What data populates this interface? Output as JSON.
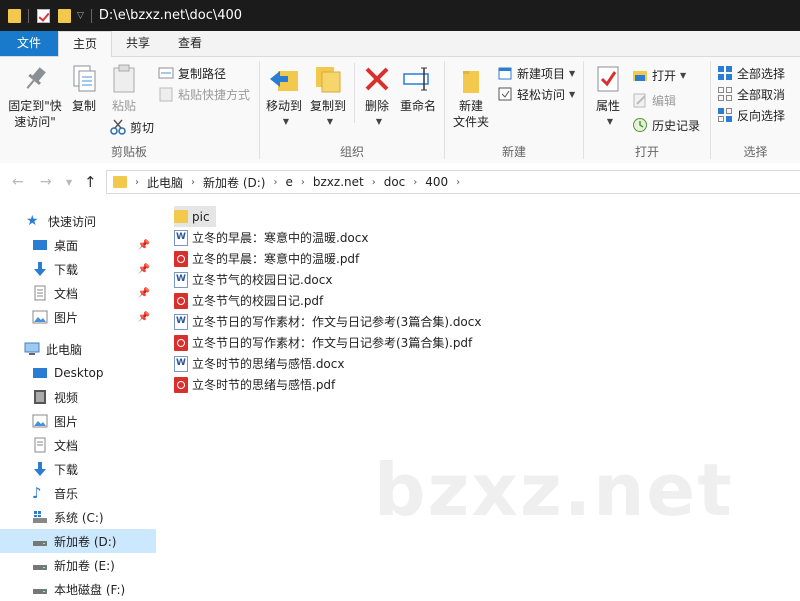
{
  "window": {
    "path": "D:\\e\\bzxz.net\\doc\\400"
  },
  "tabs": [
    "文件",
    "主页",
    "共享",
    "查看"
  ],
  "ribbon": {
    "clipboard": {
      "label": "剪贴板",
      "pin": "固定到\"快\n速访问\"",
      "copy": "复制",
      "paste": "粘贴",
      "copy_path": "复制路径",
      "paste_shortcut": "粘贴快捷方式",
      "cut": "剪切"
    },
    "organize": {
      "label": "组织",
      "move_to": "移动到",
      "copy_to": "复制到",
      "delete": "删除",
      "rename": "重命名"
    },
    "new": {
      "label": "新建",
      "new_folder": "新建\n文件夹",
      "new_item": "新建项目",
      "easy_access": "轻松访问"
    },
    "open": {
      "label": "打开",
      "properties": "属性",
      "open": "打开",
      "edit": "编辑",
      "history": "历史记录"
    },
    "select": {
      "label": "选择",
      "select_all": "全部选择",
      "select_none": "全部取消",
      "invert": "反向选择"
    }
  },
  "address": {
    "crumbs": [
      "此电脑",
      "新加卷 (D:)",
      "e",
      "bzxz.net",
      "doc",
      "400"
    ]
  },
  "sidebar": {
    "quick_access": "快速访问",
    "quick_items": [
      "桌面",
      "下载",
      "文档",
      "图片"
    ],
    "this_pc": "此电脑",
    "pc_items": [
      "Desktop",
      "视频",
      "图片",
      "文档",
      "下载",
      "音乐",
      "系统 (C:)",
      "新加卷 (D:)",
      "新加卷 (E:)",
      "本地磁盘 (F:)"
    ]
  },
  "files": [
    {
      "name": "pic",
      "type": "folder"
    },
    {
      "name": "立冬的早晨：寒意中的温暖.docx",
      "type": "docx"
    },
    {
      "name": "立冬的早晨：寒意中的温暖.pdf",
      "type": "pdf"
    },
    {
      "name": "立冬节气的校园日记.docx",
      "type": "docx"
    },
    {
      "name": "立冬节气的校园日记.pdf",
      "type": "pdf"
    },
    {
      "name": "立冬节日的写作素材：作文与日记参考(3篇合集).docx",
      "type": "docx"
    },
    {
      "name": "立冬节日的写作素材：作文与日记参考(3篇合集).pdf",
      "type": "pdf"
    },
    {
      "name": "立冬时节的思绪与感悟.docx",
      "type": "docx"
    },
    {
      "name": "立冬时节的思绪与感悟.pdf",
      "type": "pdf"
    }
  ],
  "watermark": "bzxz.net",
  "colors": {
    "file_tab": "#1979ca",
    "selection": "#cce8ff",
    "titlebar": "#1b1b1b"
  }
}
